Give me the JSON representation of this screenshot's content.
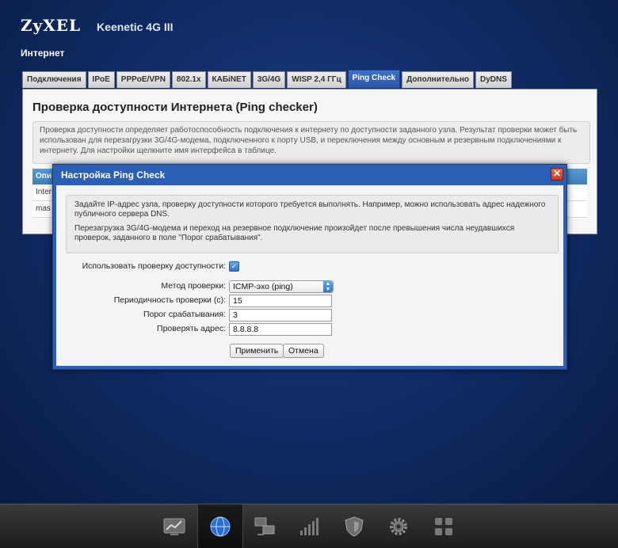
{
  "header": {
    "logo": "ZyXEL",
    "model": "Keenetic 4G III",
    "section": "Интернет"
  },
  "tabs": [
    {
      "label": "Подключения",
      "active": false
    },
    {
      "label": "IPoE",
      "active": false
    },
    {
      "label": "PPPoE/VPN",
      "active": false
    },
    {
      "label": "802.1x",
      "active": false
    },
    {
      "label": "КАБiNET",
      "active": false
    },
    {
      "label": "3G/4G",
      "active": false
    },
    {
      "label": "WISP 2,4 ГГц",
      "active": false
    },
    {
      "label": "Ping Check",
      "active": true
    },
    {
      "label": "Дополнительно",
      "active": false
    },
    {
      "label": "DyDNS",
      "active": false
    }
  ],
  "panel": {
    "title": "Проверка доступности Интернета (Ping checker)",
    "description": "Проверка доступности определяет работоспособность подключения к интернету по доступности заданного узла. Результат проверки может быть использован для перезагрузки 3G/4G-модема, подключенного к порту USB, и переключения между основным и резервным подключениями к интернету. Для настройки щелкните имя интерфейса в таблице.",
    "table": {
      "header": "Опи",
      "rows": [
        "Inter",
        "mas"
      ]
    }
  },
  "dialog": {
    "title": "Настройка Ping Check",
    "close_glyph": "✕",
    "note_p1": "Задайте IP-адрес узла, проверку доступности которого требуется выполнять. Например, можно использовать адрес надежного публичного сервера DNS.",
    "note_p2": "Перезагрузка 3G/4G-модема и переход на резервное подключение произойдет после превышения числа неудавшихся проверок, заданного в поле \"Порог срабатывания\".",
    "enable_label": "Использовать проверку доступности:",
    "enable_checked": true,
    "method_label": "Метод проверки:",
    "method_value": "ICMP-эхо (ping)",
    "interval_label": "Периодичность проверки (с):",
    "interval_value": "15",
    "threshold_label": "Порог срабатывания:",
    "threshold_value": "3",
    "address_label": "Проверять адрес:",
    "address_value": "8.8.8.8",
    "apply_label": "Применить",
    "cancel_label": "Отмена"
  },
  "dock": {
    "items": [
      "monitor-icon",
      "globe-icon",
      "network-icon",
      "signal-icon",
      "shield-icon",
      "gear-icon",
      "apps-icon"
    ],
    "active_index": 1
  },
  "colors": {
    "accent": "#2b5fb5",
    "table_header": "#3d7fbf",
    "close": "#c83a22"
  }
}
